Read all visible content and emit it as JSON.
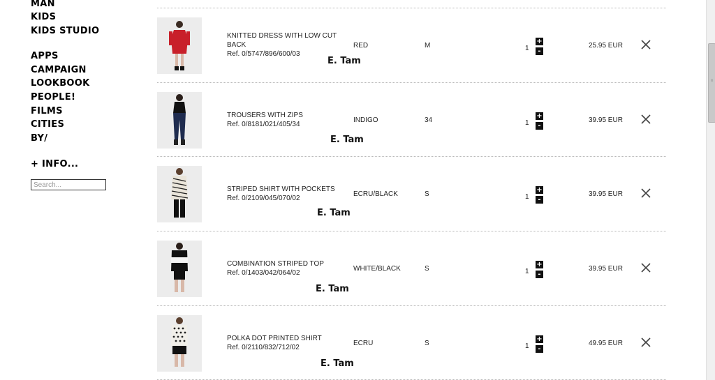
{
  "sidebar": {
    "nav_group_1": [
      "MAN",
      "KIDS",
      "KIDS STUDIO"
    ],
    "nav_group_2": [
      "APPS",
      "CAMPAIGN",
      "LOOKBOOK",
      "PEOPLE!",
      "FILMS",
      "CITIES",
      "BY/"
    ],
    "info_label": "+ INFO...",
    "search_placeholder": "Search..."
  },
  "cart": {
    "items": [
      {
        "name": "KNITTED DRESS WITH LOW CUT BACK",
        "ref": "Ref. 0/5747/896/600/03",
        "color": "RED",
        "size": "M",
        "quantity": "1",
        "price": "25.95 EUR",
        "garment_color": "#c8202a",
        "garment": "dress"
      },
      {
        "name": "TROUSERS WITH ZIPS",
        "ref": "Ref. 0/8181/021/405/34",
        "color": "INDIGO",
        "size": "34",
        "quantity": "1",
        "price": "39.95 EUR",
        "garment_color": "#1f2c4f",
        "garment": "trousers"
      },
      {
        "name": "STRIPED SHIRT WITH POCKETS",
        "ref": "Ref. 0/2109/045/070/02",
        "color": "ECRU/BLACK",
        "size": "S",
        "quantity": "1",
        "price": "39.95 EUR",
        "garment_color": "#e8e3d8",
        "garment": "striped-shirt"
      },
      {
        "name": "COMBINATION STRIPED TOP",
        "ref": "Ref. 0/1403/042/064/02",
        "color": "WHITE/BLACK",
        "size": "S",
        "quantity": "1",
        "price": "39.95 EUR",
        "garment_color": "#111111",
        "garment": "combo-top"
      },
      {
        "name": "POLKA DOT PRINTED SHIRT",
        "ref": "Ref. 0/2110/832/712/02",
        "color": "ECRU",
        "size": "S",
        "quantity": "1",
        "price": "49.95 EUR",
        "garment_color": "#f1efe9",
        "garment": "polka-shirt"
      }
    ],
    "plus_symbol": "+",
    "minus_symbol": "-"
  },
  "watermark": "E. Tam",
  "icons": {
    "remove": "close-icon",
    "increase": "plus-icon",
    "decrease": "minus-icon"
  }
}
